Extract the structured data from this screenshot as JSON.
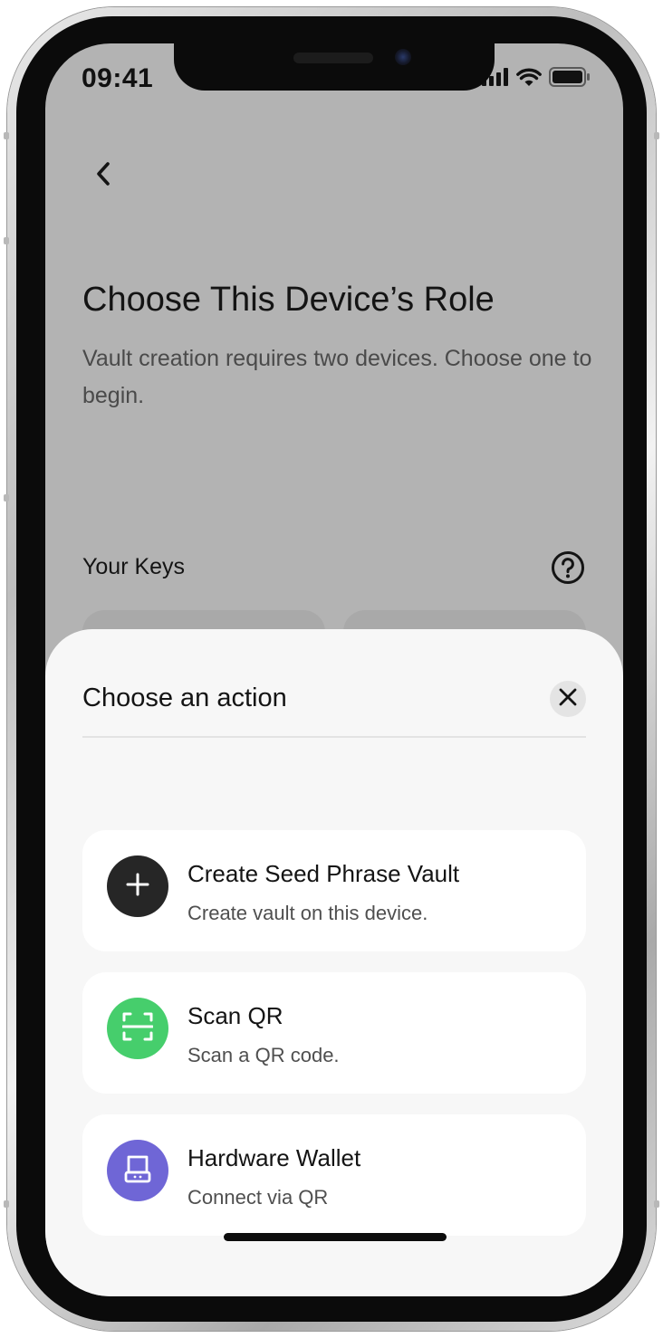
{
  "status_bar": {
    "time": "09:41"
  },
  "header": {
    "back_icon": "chevron-left-icon",
    "title": "Choose This Device’s Role",
    "subtitle": "Vault creation requires two devices. Choose one to begin."
  },
  "keys_section": {
    "label": "Your Keys",
    "help_icon": "question-circle-icon"
  },
  "action_sheet": {
    "title": "Choose an action",
    "close_icon": "close-icon",
    "actions": [
      {
        "title": "Create Seed Phrase Vault",
        "description": "Create vault on this device.",
        "icon": "plus-icon",
        "icon_color": "#262626"
      },
      {
        "title": "Scan QR",
        "description": "Scan a QR code.",
        "icon": "scan-qr-icon",
        "icon_color": "#46ce6c"
      },
      {
        "title": "Hardware Wallet",
        "description": "Connect via QR",
        "icon": "hardware-wallet-icon",
        "icon_color": "#6f66d6"
      }
    ]
  }
}
